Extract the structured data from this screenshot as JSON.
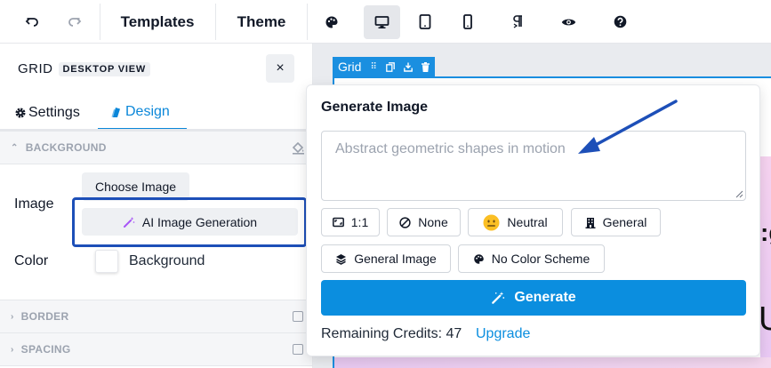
{
  "toolbar": {
    "templates_label": "Templates",
    "theme_label": "Theme"
  },
  "panel": {
    "title": "GRID",
    "view_badge": "DESKTOP VIEW",
    "close_glyph": "×",
    "tabs": {
      "settings": "Settings",
      "design": "Design"
    },
    "sections": {
      "background": "BACKGROUND",
      "border": "BORDER",
      "spacing": "SPACING"
    },
    "image_label": "Image",
    "choose_image": "Choose Image",
    "ai_image_generation": "AI Image Generation",
    "color_label": "Color",
    "color_value": "Background"
  },
  "canvas": {
    "grid_tag": "Grid"
  },
  "popover": {
    "title": "Generate Image",
    "prompt_placeholder": "Abstract geometric shapes in motion",
    "chips": {
      "ratio": "1:1",
      "style": "None",
      "mood": "Neutral",
      "category": "General",
      "type": "General Image",
      "color_scheme": "No Color Scheme"
    },
    "generate": "Generate",
    "credits_text": "Remaining Credits: 47",
    "upgrade": "Upgrade"
  },
  "colors": {
    "accent": "#0b8edf",
    "highlight": "#1d4fb8",
    "grid_blue": "#1a8fe0"
  },
  "icons": [
    "undo-icon",
    "redo-icon",
    "palette-icon",
    "desktop-icon",
    "tablet-icon",
    "mobile-icon",
    "paragraph-icon",
    "eye-icon",
    "help-icon",
    "gear-icon",
    "design-icon",
    "magic-wand-icon",
    "ban-icon",
    "neutral-face-icon",
    "building-icon",
    "layers-icon",
    "palette-icon"
  ]
}
